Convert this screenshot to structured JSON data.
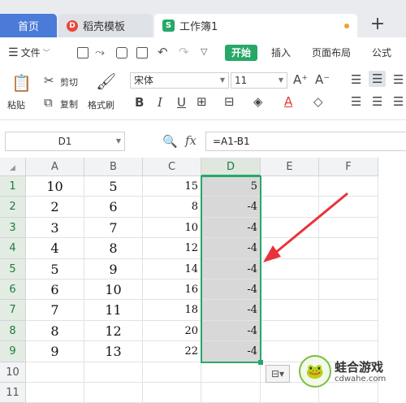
{
  "tabs": {
    "home": "首页",
    "template": "稻壳模板",
    "workbook": "工作簿1",
    "template_icon": "D",
    "workbook_icon": "S",
    "new_tab": "+"
  },
  "menu": {
    "file": "文件",
    "start": "开始",
    "insert": "插入",
    "page_layout": "页面布局",
    "formula": "公式"
  },
  "ribbon": {
    "paste": "粘贴",
    "cut": "剪切",
    "copy": "复制",
    "format_painter": "格式刷",
    "font_name": "宋体",
    "font_size": "11",
    "bold": "B",
    "italic": "I",
    "underline": "U",
    "grow": "A⁺",
    "shrink": "A⁻",
    "font_color_letter": "A"
  },
  "formula_bar": {
    "name_box": "D1",
    "fx": "fx",
    "formula": "=A1-B1"
  },
  "columns": [
    "A",
    "B",
    "C",
    "D",
    "E",
    "F"
  ],
  "rows": [
    {
      "n": "1",
      "A": "10",
      "B": "5",
      "C": "15",
      "D": "5"
    },
    {
      "n": "2",
      "A": "2",
      "B": "6",
      "C": "8",
      "D": "-4"
    },
    {
      "n": "3",
      "A": "3",
      "B": "7",
      "C": "10",
      "D": "-4"
    },
    {
      "n": "4",
      "A": "4",
      "B": "8",
      "C": "12",
      "D": "-4"
    },
    {
      "n": "5",
      "A": "5",
      "B": "9",
      "C": "14",
      "D": "-4"
    },
    {
      "n": "6",
      "A": "6",
      "B": "10",
      "C": "16",
      "D": "-4"
    },
    {
      "n": "7",
      "A": "7",
      "B": "11",
      "C": "18",
      "D": "-4"
    },
    {
      "n": "8",
      "A": "8",
      "B": "12",
      "C": "20",
      "D": "-4"
    },
    {
      "n": "9",
      "A": "9",
      "B": "13",
      "C": "22",
      "D": "-4"
    },
    {
      "n": "10",
      "A": "",
      "B": "",
      "C": "",
      "D": ""
    },
    {
      "n": "11",
      "A": "",
      "B": "",
      "C": "",
      "D": ""
    }
  ],
  "watermark": {
    "title": "蛙合游戏",
    "url": "cdwahe.com"
  },
  "colors": {
    "accent": "#27a868",
    "arrow": "#e8333a",
    "home_tab": "#4a7bd8"
  }
}
